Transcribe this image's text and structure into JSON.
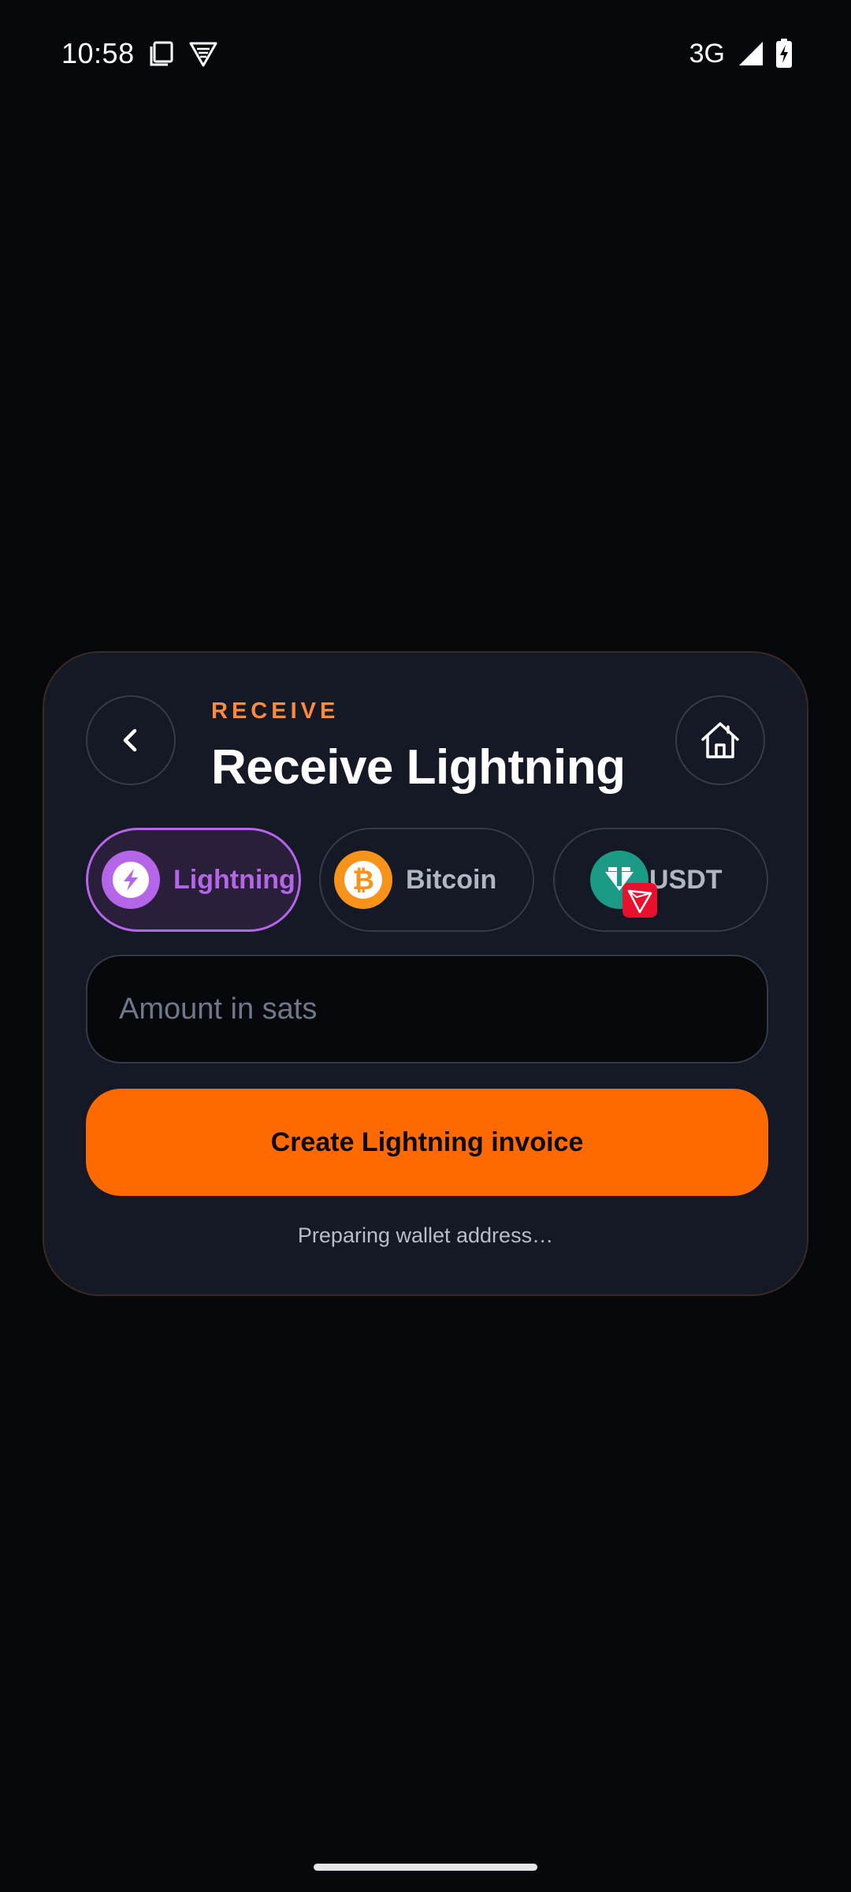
{
  "status_bar": {
    "time": "10:58",
    "network": "3G",
    "icons": [
      "notes-icon",
      "vpn-shield-icon",
      "signal-icon",
      "battery-charging-icon"
    ]
  },
  "card": {
    "eyebrow": "RECEIVE",
    "title": "Receive Lightning",
    "back_icon": "chevron-left-icon",
    "home_icon": "home-icon"
  },
  "tabs": [
    {
      "label": "Lightning",
      "icon": "lightning-icon",
      "active": true,
      "color": "#b565e8"
    },
    {
      "label": "Bitcoin",
      "icon": "bitcoin-icon",
      "active": false,
      "color": "#f7931a"
    },
    {
      "label": "USDT",
      "icon": "tether-tron-icon",
      "active": false,
      "color": "#26a17b"
    }
  ],
  "amount": {
    "value": "",
    "placeholder": "Amount in sats"
  },
  "create_button": {
    "label": "Create Lightning invoice",
    "color": "#ff6a00"
  },
  "status_message": "Preparing wallet address…",
  "colors": {
    "background": "#07080c",
    "card": "#141925",
    "accent_orange": "#ff8a3d",
    "accent_purple": "#b565e8"
  }
}
